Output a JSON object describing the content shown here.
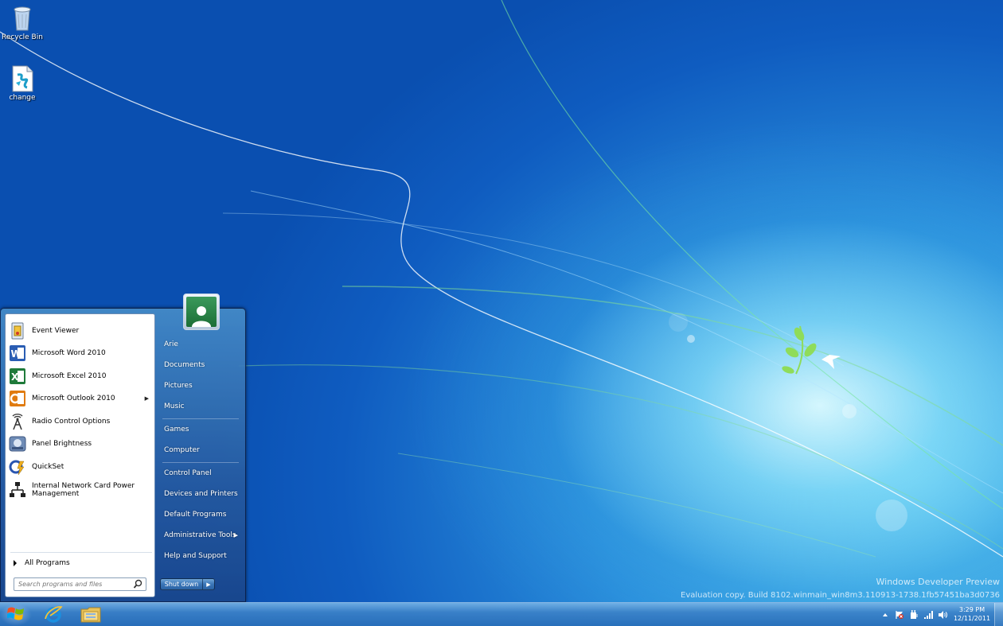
{
  "desktop": {
    "icons": [
      {
        "label": "Recycle Bin",
        "icon": "recycle-bin-icon"
      },
      {
        "label": "change",
        "icon": "script-file-icon"
      }
    ],
    "watermark_line1": "Windows Developer Preview",
    "watermark_line2": "Evaluation copy. Build 8102.winmain_win8m3.110913-1738.1fb57451ba3d0736"
  },
  "start_menu": {
    "programs": [
      {
        "label": "Event Viewer",
        "icon": "event-viewer-icon",
        "has_submenu": false
      },
      {
        "label": "Microsoft Word 2010",
        "icon": "word-icon",
        "has_submenu": false
      },
      {
        "label": "Microsoft Excel 2010",
        "icon": "excel-icon",
        "has_submenu": false
      },
      {
        "label": "Microsoft Outlook 2010",
        "icon": "outlook-icon",
        "has_submenu": true
      },
      {
        "label": "Radio Control Options",
        "icon": "radio-antenna-icon",
        "has_submenu": false
      },
      {
        "label": "Panel Brightness",
        "icon": "brightness-icon",
        "has_submenu": false
      },
      {
        "label": "QuickSet",
        "icon": "quickset-icon",
        "has_submenu": false
      },
      {
        "label": "Internal Network Card Power Management",
        "icon": "network-icon",
        "has_submenu": false
      }
    ],
    "all_programs": "All Programs",
    "search_placeholder": "Search programs and files",
    "right_items": [
      {
        "label": "Arie",
        "has_submenu": false
      },
      {
        "label": "Documents",
        "has_submenu": false
      },
      {
        "label": "Pictures",
        "has_submenu": false
      },
      {
        "label": "Music",
        "has_submenu": false
      },
      {
        "label": "Games",
        "has_submenu": false
      },
      {
        "label": "Computer",
        "has_submenu": false
      },
      {
        "label": "Control Panel",
        "has_submenu": false
      },
      {
        "label": "Devices and Printers",
        "has_submenu": false
      },
      {
        "label": "Default Programs",
        "has_submenu": false
      },
      {
        "label": "Administrative Tools",
        "has_submenu": true
      },
      {
        "label": "Help and Support",
        "has_submenu": false
      }
    ],
    "shutdown_label": "Shut down"
  },
  "taskbar": {
    "pinned": [
      "windows-logo-icon",
      "internet-explorer-icon",
      "file-explorer-icon"
    ],
    "tray_icons": [
      "show-hidden-icons-chevron",
      "action-center-flag-icon",
      "power-icon",
      "network-signal-icon",
      "volume-icon"
    ],
    "clock_time": "3:29 PM",
    "clock_date": "12/11/2011"
  },
  "colors": {
    "accent": "#1e72c8",
    "start_menu_right": "#2a5e9f",
    "text_dark": "#000000"
  }
}
